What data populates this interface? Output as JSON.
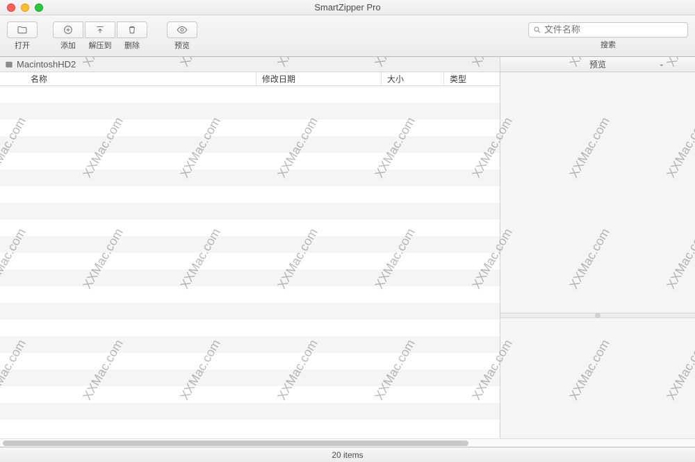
{
  "window": {
    "title": "SmartZipper Pro"
  },
  "toolbar": {
    "open": "打开",
    "add": "添加",
    "extract": "解压到",
    "delete": "删除",
    "preview": "预览",
    "search_label": "搜索",
    "search_placeholder": "文件名称"
  },
  "breadcrumb": {
    "path": "MacintoshHD2"
  },
  "columns": {
    "name": "名称",
    "date": "修改日期",
    "size": "大小",
    "type": "类型"
  },
  "preview": {
    "title": "预览"
  },
  "status": {
    "text": "20 items"
  },
  "row_count": 20,
  "watermark": "XXMac.com"
}
